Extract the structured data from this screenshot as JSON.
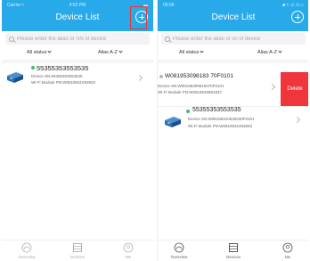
{
  "left_screen": {
    "status": {
      "carrier": "Carrier ≈",
      "time": "4:52 PM",
      "battery": "▬"
    },
    "header": {
      "title": "Device List",
      "add_icon": "plus-circle-icon"
    },
    "search": {
      "placeholder": "Please enter the alias or SN of device"
    },
    "filters": {
      "status_label": "All status",
      "sort_label": "Alias A-Z"
    },
    "devices": [
      {
        "name": "55355353553535",
        "status_color": "#3cc06b",
        "sn_line": "Device SN:55355353553535",
        "pn_line": "Wi-Fi Module PN:W0819531053833"
      }
    ],
    "nav": [
      {
        "label": "Overview",
        "icon": "overview-gauge-icon"
      },
      {
        "label": "Devices",
        "icon": "devices-icon"
      },
      {
        "label": "Me",
        "icon": "user-icon"
      }
    ]
  },
  "right_screen": {
    "status": {
      "time": "09:06",
      "icons": "■ ≈ .ıl .ıl ▭"
    },
    "header": {
      "title": "Device List",
      "add_icon": "plus-circle-icon"
    },
    "search": {
      "placeholder": "Please enter the alias or sn of device"
    },
    "filters": {
      "status_label": "All status",
      "sort_label": "Alias A-Z"
    },
    "devices": [
      {
        "name": "W081953098183 70F0101",
        "status_color": "#b7b7b7",
        "sn_line": "Device SN:W08195309818370F0101",
        "pn_line": "Wi-Fi Module PN:W0819530981837",
        "action": "Delete"
      },
      {
        "name": "55355353553535",
        "status_color": "#3cc06b",
        "sn_line": "Device SN:W08195310538330F0101",
        "pn_line": "Wi-Fi Module PN:W0819531053833"
      }
    ],
    "nav": [
      {
        "label": "Overview",
        "icon": "overview-gauge-icon"
      },
      {
        "label": "Devices",
        "icon": "devices-icon"
      },
      {
        "label": "Me",
        "icon": "user-icon"
      }
    ]
  },
  "colors": {
    "header_blue": "#28a9ea",
    "online_green": "#3cc06b",
    "offline_gray": "#b7b7b7",
    "delete_red": "#f0353b",
    "annotation_red": "#e53935"
  }
}
